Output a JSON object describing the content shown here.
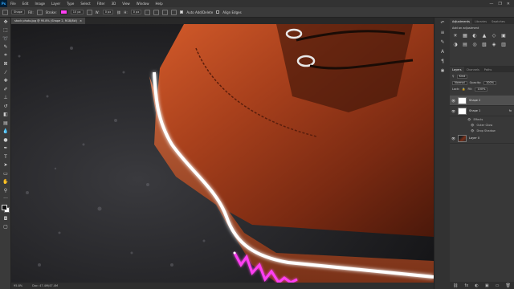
{
  "menu": {
    "logo": "Ps",
    "items": [
      "File",
      "Edit",
      "Image",
      "Layer",
      "Type",
      "Select",
      "Filter",
      "3D",
      "View",
      "Window",
      "Help"
    ],
    "window_controls": [
      "—",
      "❐",
      "✕"
    ]
  },
  "options": {
    "mode": "Shape",
    "fill_label": "Fill:",
    "stroke_label": "Stroke:",
    "stroke_color": "#ff3ff2",
    "stroke_width": "10 px",
    "w_label": "W:",
    "w_value": "0 px",
    "h_label": "H:",
    "h_value": "0 px",
    "auto_add_delete": "Auto Add/Delete",
    "align_edges": "Align Edges"
  },
  "document": {
    "tab_title": "stock photo.jpg @ 95.8% (Shape 2, RGB/8#)",
    "close": "×"
  },
  "status": {
    "zoom": "95.8%",
    "doc_info": "Doc: 47.4M/47.4M"
  },
  "adjustments": {
    "tabs": [
      "Adjustments",
      "Libraries",
      "Swatches"
    ],
    "hint": "Add an adjustment",
    "icons": [
      "☀",
      "▦",
      "◐",
      "▲",
      "◇",
      "▣",
      "◑",
      "▤",
      "◎",
      "▧",
      "◈",
      "▥"
    ]
  },
  "layers_panel": {
    "tabs": [
      "Layers",
      "Channels",
      "Paths"
    ],
    "kind_label": "Kind",
    "blend_mode": "Normal",
    "opacity_label": "Opacity:",
    "opacity_value": "100%",
    "lock_label": "Lock:",
    "fill_label": "Fill:",
    "fill_value": "100%",
    "layers": [
      {
        "name": "Shape 2",
        "selected": true
      },
      {
        "name": "Shape 1",
        "selected": false,
        "fx": "fx"
      },
      {
        "name": "Layer 0",
        "selected": false
      }
    ],
    "effects": {
      "label": "Effects",
      "items": [
        "Outer Glow",
        "Drop Shadow"
      ]
    },
    "footer_icons": [
      "⛓",
      "fx",
      "◐",
      "▣",
      "▭",
      "🗑"
    ]
  },
  "colors": {
    "accent": "#31a8ff",
    "neon_glow": "#ffffff",
    "shape_stroke": "#ff3ff2"
  }
}
